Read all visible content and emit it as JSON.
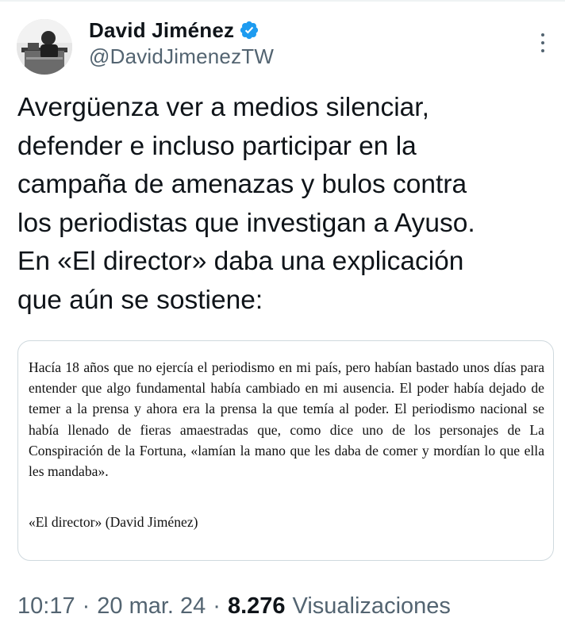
{
  "author": {
    "display_name": "David Jiménez",
    "handle": "@DavidJimenezTW",
    "verified": true,
    "verified_color": "#1d9bf0"
  },
  "tweet": {
    "lines": [
      "Avergüenza ver a medios silenciar,",
      "defender e incluso participar en la",
      "campaña de amenazas y bulos contra",
      "los periodistas que investigan a Ayuso.",
      "En «El director» daba una explicación",
      "que aún se sostiene:"
    ]
  },
  "quote_image": {
    "text": "Hacía 18 años que no ejercía el periodismo en mi país, pero habían bastado unos días para entender que algo fundamental había cambiado en mi ausencia. El poder había dejado de temer a la prensa y ahora era la prensa la que temía al poder. El periodismo nacional se había llenado de fieras amaestradas que, como dice uno de los personajes de La Conspiración de la Fortuna, «lamían la mano que les daba de comer y mordían lo que ella les mandaba».",
    "source": "«El director» (David Jiménez)"
  },
  "meta": {
    "time": "10:17",
    "separator": "·",
    "date": "20 mar. 24",
    "views_count": "8.276",
    "views_label": "Visualizaciones"
  },
  "icons": {
    "avatar": "avatar-photo",
    "verified": "verified-badge-icon",
    "more": "more-options-icon"
  }
}
